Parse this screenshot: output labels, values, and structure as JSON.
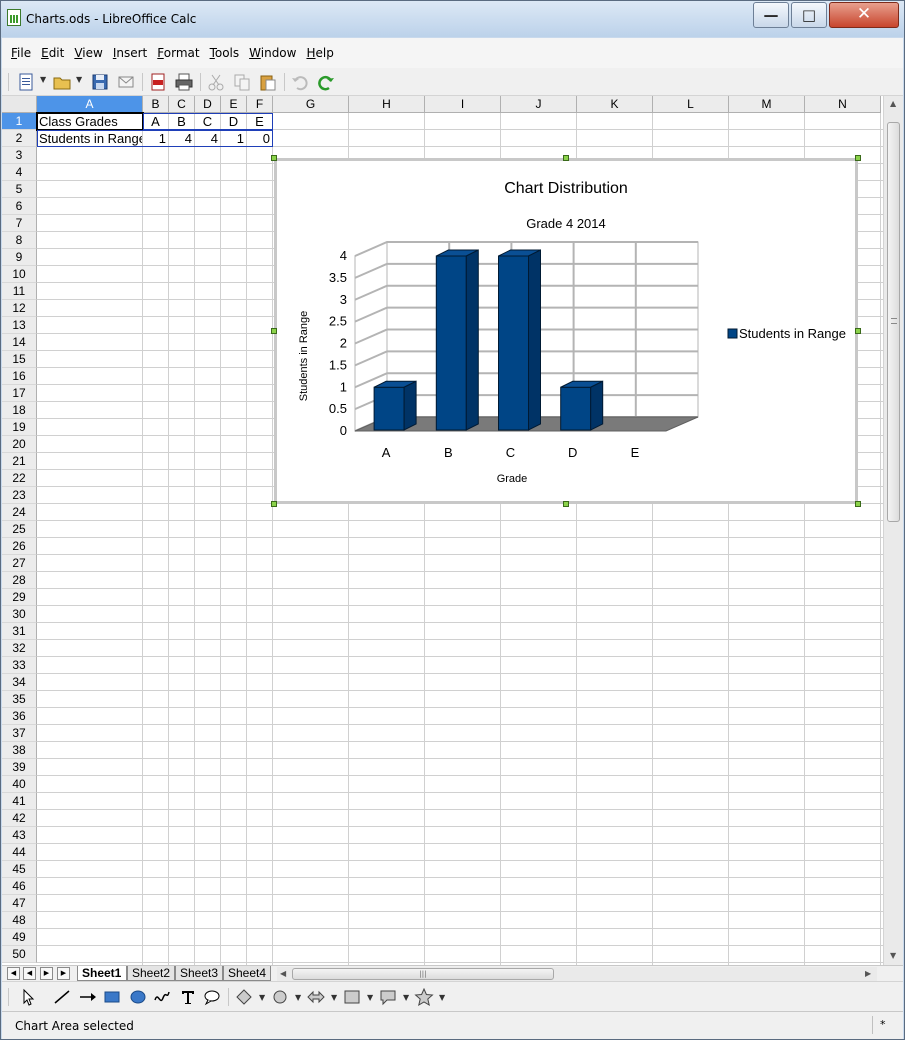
{
  "window": {
    "title": "Charts.ods - LibreOffice Calc"
  },
  "menu": [
    "File",
    "Edit",
    "View",
    "Insert",
    "Format",
    "Tools",
    "Window",
    "Help"
  ],
  "columns": [
    "A",
    "B",
    "C",
    "D",
    "E",
    "F",
    "G",
    "H",
    "I",
    "J",
    "K",
    "L",
    "M",
    "N"
  ],
  "selected_column": "A",
  "rows_visible": 50,
  "selected_row": 1,
  "cells": {
    "A1": "Class Grades",
    "B1": "A",
    "C1": "B",
    "D1": "C",
    "E1": "D",
    "F1": "E",
    "A2": "Students in Range",
    "B2": "1",
    "C2": "4",
    "D2": "4",
    "E2": "1",
    "F2": "0"
  },
  "chart_data": {
    "type": "bar",
    "title": "Chart Distribution",
    "subtitle": "Grade 4 2014",
    "xlabel": "Grade",
    "ylabel": "Students in Range",
    "categories": [
      "A",
      "B",
      "C",
      "D",
      "E"
    ],
    "series": [
      {
        "name": "Students in Range",
        "values": [
          1,
          4,
          4,
          1,
          0
        ],
        "color": "#004586"
      }
    ],
    "ylim": [
      0,
      4
    ],
    "yticks": [
      "0",
      "0.5",
      "1",
      "1.5",
      "2",
      "2.5",
      "3",
      "3.5",
      "4"
    ],
    "grid": true,
    "legend": "right",
    "three_d": true
  },
  "sheets": [
    "Sheet1",
    "Sheet2",
    "Sheet3",
    "Sheet4"
  ],
  "active_sheet": "Sheet1",
  "status": {
    "text": "Chart Area selected",
    "modified": "*"
  },
  "icons": {
    "toolbar": [
      "new-document-icon",
      "open-folder-icon",
      "save-icon",
      "email-icon",
      "export-pdf-icon",
      "print-icon",
      "cut-icon",
      "copy-icon",
      "paste-icon",
      "undo-icon",
      "redo-icon"
    ],
    "drawing": [
      "select-arrow-icon",
      "line-icon",
      "arrow-line-icon",
      "rectangle-icon",
      "ellipse-icon",
      "freeform-icon",
      "text-icon",
      "callout-icon",
      "basic-shapes-icon",
      "symbol-shapes-icon",
      "block-arrows-icon",
      "flowchart-icon",
      "callouts-icon",
      "stars-icon"
    ]
  }
}
